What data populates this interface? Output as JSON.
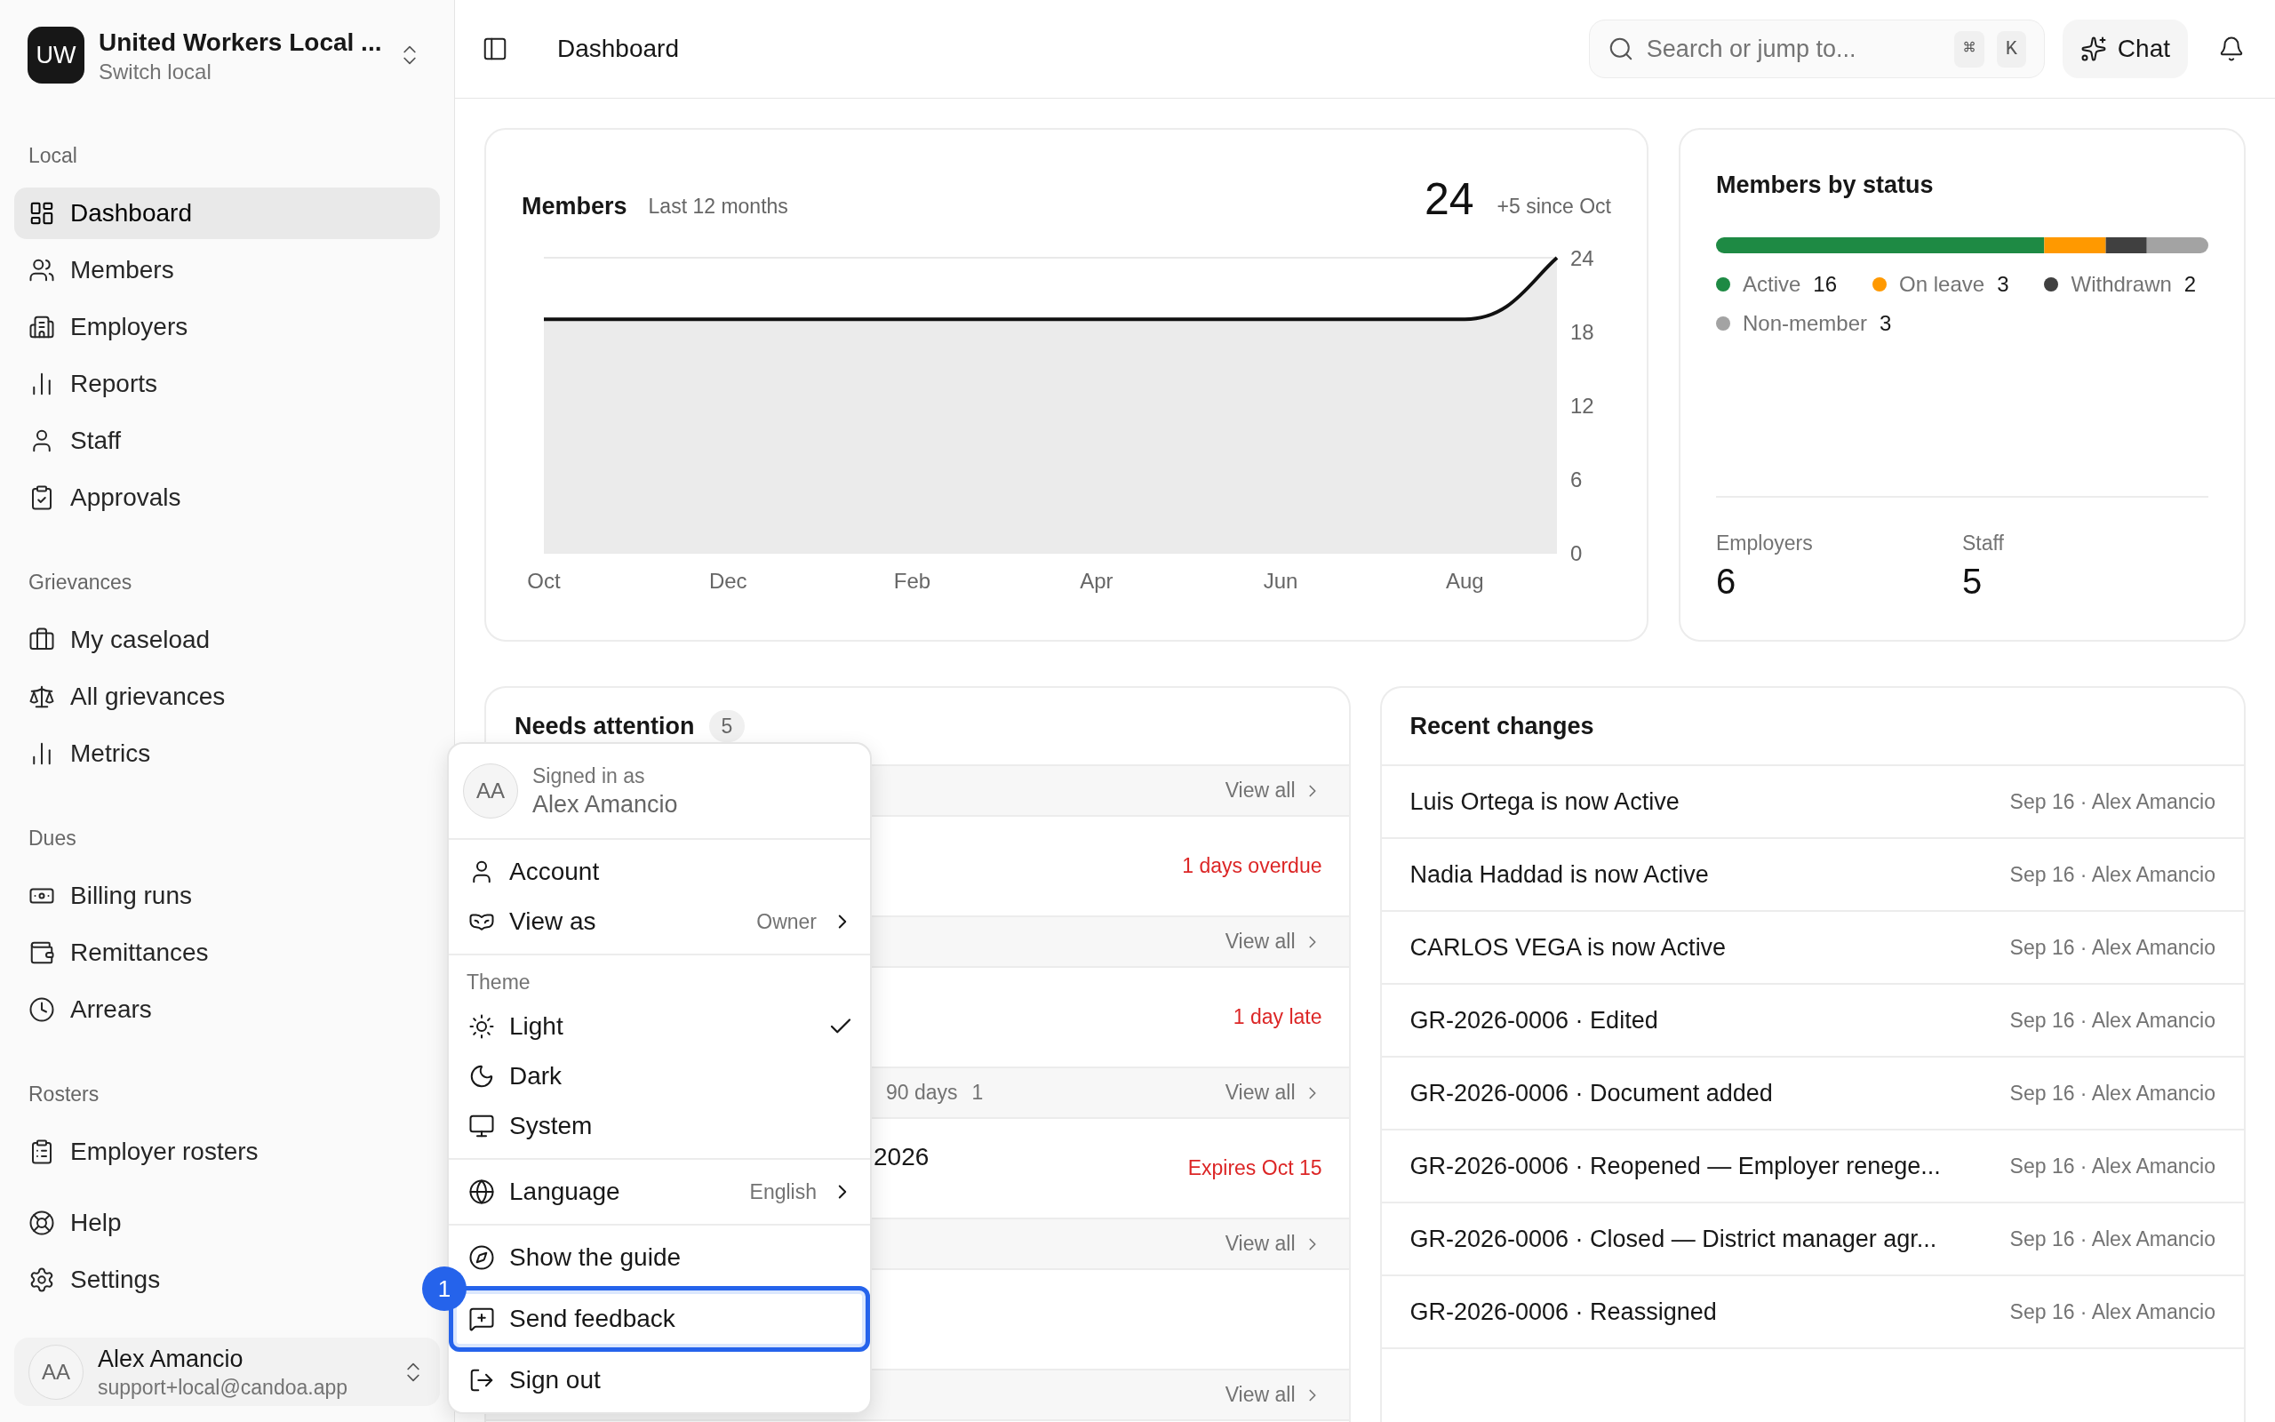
{
  "sidebar": {
    "org": {
      "logo": "UW",
      "name": "United Workers Local ...",
      "subtitle": "Switch local"
    },
    "sections": [
      {
        "heading": "Local",
        "items": [
          {
            "label": "Dashboard",
            "selected": true
          },
          {
            "label": "Members",
            "selected": false
          },
          {
            "label": "Employers",
            "selected": false
          },
          {
            "label": "Reports",
            "selected": false
          },
          {
            "label": "Staff",
            "selected": false
          },
          {
            "label": "Approvals",
            "selected": false
          }
        ]
      },
      {
        "heading": "Grievances",
        "items": [
          {
            "label": "My caseload",
            "selected": false
          },
          {
            "label": "All grievances",
            "selected": false
          },
          {
            "label": "Metrics",
            "selected": false
          }
        ]
      },
      {
        "heading": "Dues",
        "items": [
          {
            "label": "Billing runs",
            "selected": false
          },
          {
            "label": "Remittances",
            "selected": false
          },
          {
            "label": "Arrears",
            "selected": false
          }
        ]
      },
      {
        "heading": "Rosters",
        "items": [
          {
            "label": "Employer rosters",
            "selected": false
          }
        ]
      },
      {
        "items": [
          {
            "label": "Help",
            "selected": false
          },
          {
            "label": "Settings",
            "selected": false
          }
        ]
      }
    ],
    "user": {
      "avatar": "AA",
      "name": "Alex Amancio",
      "email": "support+local@candoa.app"
    }
  },
  "header": {
    "title": "Dashboard",
    "search": {
      "placeholder": "Search or jump to...",
      "keys": [
        "⌘",
        "K"
      ]
    },
    "chat": "Chat"
  },
  "members_card": {
    "subtitle": "Last 12 months",
    "total": "24",
    "delta": "+5 since Oct",
    "chart_data": {
      "type": "area",
      "title": "Members",
      "categories": [
        "Oct",
        null,
        "Dec",
        null,
        "Feb",
        null,
        "Apr",
        null,
        "Jun",
        null,
        "Aug",
        null
      ],
      "ylim": [
        0,
        24
      ],
      "yticks": [
        0,
        6,
        12,
        18,
        24
      ],
      "series": [
        {
          "color": "#111111",
          "values": [
            19,
            19,
            19,
            19,
            19,
            19,
            19,
            19,
            19,
            19,
            19,
            24
          ]
        }
      ]
    }
  },
  "members_by_status": {
    "title": "Members by status",
    "legend": [
      {
        "label": "Active",
        "count": "16",
        "color": "#1e8a44"
      },
      {
        "label": "On leave",
        "count": "3",
        "color": "#ff9900"
      },
      {
        "label": "Withdrawn",
        "count": "2",
        "color": "#404040"
      },
      {
        "label": "Non-member",
        "count": "3",
        "color": "#a3a3a3"
      }
    ],
    "stats": [
      {
        "label": "Employers",
        "value": "6"
      },
      {
        "label": "Staff",
        "value": "5"
      }
    ]
  },
  "needs_attention": {
    "title": "Needs attention",
    "count": "5",
    "sections": [
      {
        "link": "View all",
        "rows": [
          {
            "status": "1 days overdue"
          }
        ]
      },
      {
        "link": "View all",
        "rows": [
          {
            "status": "1 day late"
          }
        ]
      },
      {
        "label": "90 days",
        "count": "1",
        "link": "View all",
        "rows": [
          {
            "title": "2026",
            "status": "Expires Oct 15"
          }
        ]
      },
      {
        "link": "View all"
      },
      {
        "link": "View all"
      }
    ]
  },
  "recent_changes": {
    "title": "Recent changes",
    "rows": [
      {
        "text": "Luis Ortega is now Active",
        "meta": "Sep 16 · Alex Amancio"
      },
      {
        "text": "Nadia Haddad is now Active",
        "meta": "Sep 16 · Alex Amancio"
      },
      {
        "text": "CARLOS VEGA is now Active",
        "meta": "Sep 16 · Alex Amancio"
      },
      {
        "text": "GR-2026-0006 · Edited",
        "meta": "Sep 16 · Alex Amancio"
      },
      {
        "text": "GR-2026-0006 · Document added",
        "meta": "Sep 16 · Alex Amancio"
      },
      {
        "text": "GR-2026-0006 · Reopened — Employer renege...",
        "meta": "Sep 16 · Alex Amancio"
      },
      {
        "text": "GR-2026-0006 · Closed — District manager agr...",
        "meta": "Sep 16 · Alex Amancio"
      },
      {
        "text": "GR-2026-0006 · Reassigned",
        "meta": "Sep 16 · Alex Amancio"
      }
    ]
  },
  "user_menu": {
    "avatar": "AA",
    "signed_in_label": "Signed in as",
    "name": "Alex Amancio",
    "groups": [
      {
        "items": [
          {
            "kind": "action",
            "label": "Account",
            "highlighted": false
          },
          {
            "kind": "submenu",
            "label": "View as",
            "value": "Owner",
            "highlighted": false
          }
        ]
      },
      {
        "heading": "Theme",
        "items": [
          {
            "kind": "radio",
            "label": "Light",
            "selected": true
          },
          {
            "kind": "radio",
            "label": "Dark",
            "selected": false
          },
          {
            "kind": "radio",
            "label": "System",
            "selected": false
          }
        ]
      },
      {
        "items": [
          {
            "kind": "submenu",
            "label": "Language",
            "value": "English",
            "highlighted": false
          }
        ]
      },
      {
        "items": [
          {
            "kind": "action",
            "label": "Show the guide",
            "highlighted": false
          },
          {
            "kind": "action",
            "label": "Send feedback",
            "highlighted": true,
            "step": "1"
          },
          {
            "kind": "action",
            "label": "Sign out",
            "highlighted": false
          }
        ]
      }
    ]
  }
}
